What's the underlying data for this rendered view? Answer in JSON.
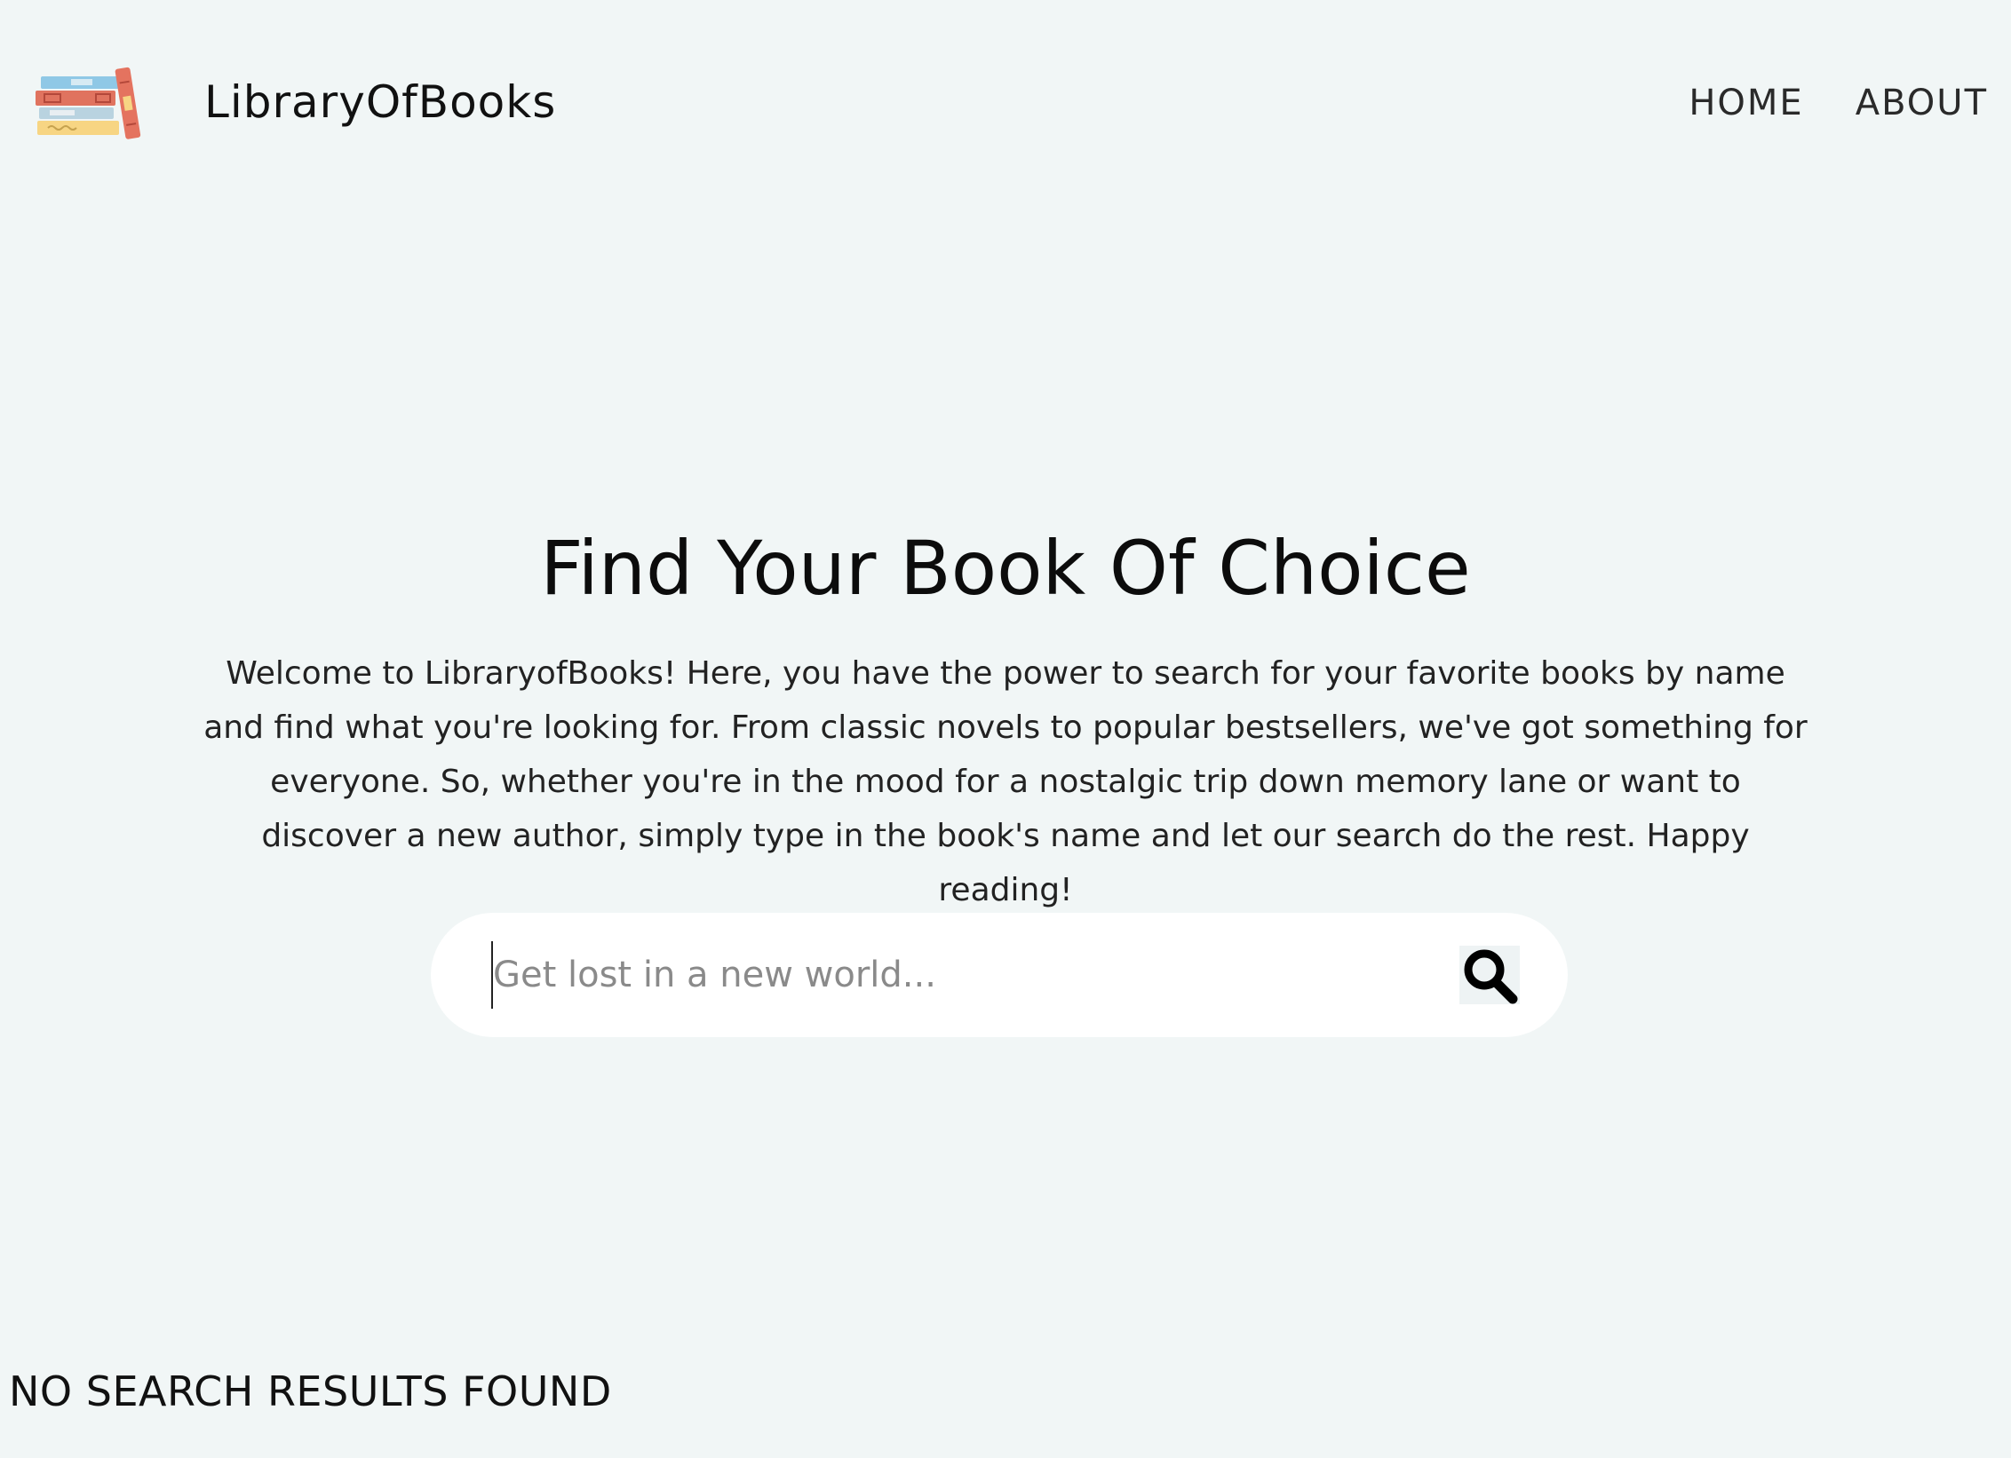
{
  "header": {
    "brand_name": "LibraryOfBooks",
    "nav": [
      {
        "label": "HOME"
      },
      {
        "label": "ABOUT"
      }
    ]
  },
  "hero": {
    "title": "Find Your Book Of Choice",
    "description": "Welcome to LibraryofBooks! Here, you have the power to search for your favorite books by name and find what you're looking for. From classic novels to popular bestsellers, we've got something for everyone. So, whether you're in the mood for a nostalgic trip down memory lane or want to discover a new author, simply type in the book's name and let our search do the rest. Happy reading!"
  },
  "search": {
    "placeholder": "Get lost in a new world...",
    "value": "",
    "button_icon": "search-icon"
  },
  "results": {
    "status_text": "NO SEARCH RESULTS FOUND"
  },
  "colors": {
    "background": "#f1f6f6",
    "search_box": "#ffffff",
    "text": "#111111"
  }
}
